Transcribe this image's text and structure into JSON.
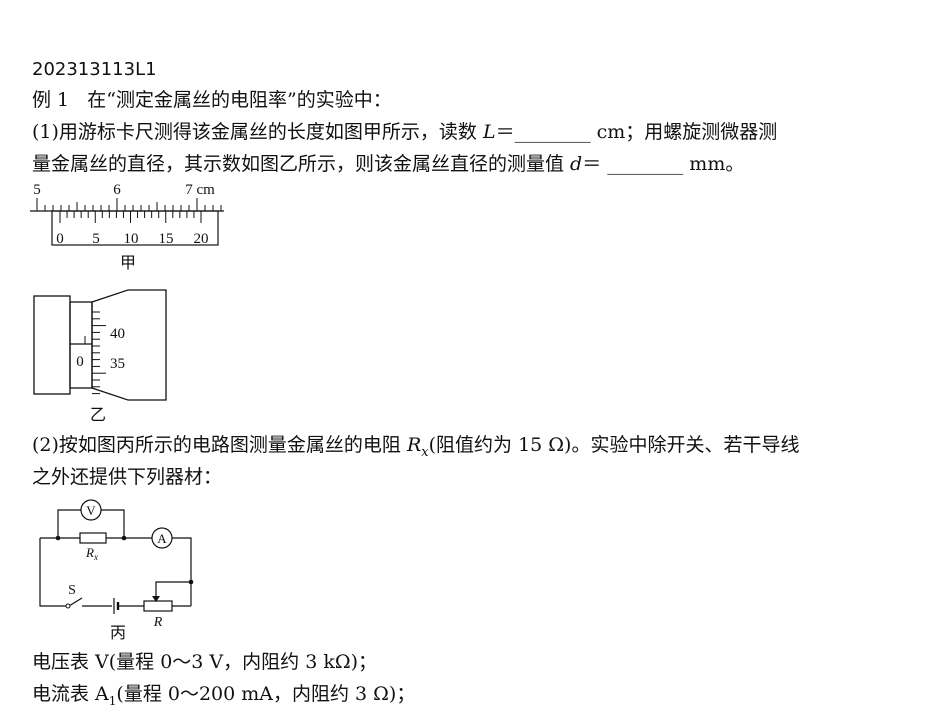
{
  "doc": {
    "code": "202313113L1",
    "example_label": "例 1",
    "example_title": "在“测定金属丝的电阻率”的实验中：",
    "q1_line1_a": "(1)用游标卡尺测得该金属丝的长度如图甲所示，读数 ",
    "q1_var_L": "L",
    "q1_line1_b": "＝________ cm；用螺旋测微器测",
    "q1_line2_a": "量金属丝的直径，其示数如图乙所示，则该金属丝直径的测量值 ",
    "q1_var_d": "d",
    "q1_line2_b": "＝ ________ mm。",
    "q2_line1_a": "(2)按如图丙所示的电路图测量金属丝的电阻 ",
    "q2_var_R": "R",
    "q2_var_sub": "x",
    "q2_line1_b": "(阻值约为 15 Ω)。实验中除开关、若干导线",
    "q2_line2": "之外还提供下列器材：",
    "item1": "电压表 V(量程 0～3 V，内阻约 3 kΩ)；",
    "item2_a": "电流表 A",
    "item2_sub": "1",
    "item2_b": "(量程 0～200 mA，内阻约 3 Ω)；"
  },
  "fig_jia": {
    "main_labels": [
      "5",
      "6",
      "7 cm"
    ],
    "vernier_labels": [
      "0",
      "5",
      "10",
      "15",
      "20"
    ],
    "caption": "甲"
  },
  "fig_yi": {
    "scale_labels": [
      "40",
      "35"
    ],
    "zero_label": "0",
    "caption": "乙"
  },
  "fig_bing": {
    "voltmeter": "V",
    "ammeter": "A",
    "resistor_main": "R",
    "resistor_sub": "x",
    "switch": "S",
    "rheostat": "R",
    "caption": "丙"
  }
}
